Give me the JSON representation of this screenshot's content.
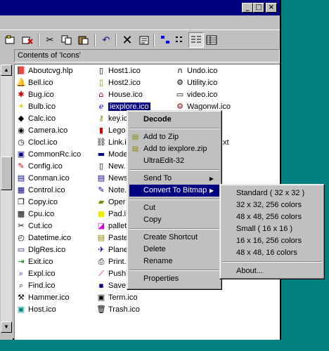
{
  "window": {
    "controls": [
      "_",
      "□",
      "×"
    ]
  },
  "toolbar": {
    "tools": [
      "new-icon",
      "delete-icon",
      "cut-icon",
      "copy-icon",
      "paste-icon",
      "undo-icon",
      "delete-x-icon",
      "properties-icon",
      "large-icons-view",
      "small-icons-view",
      "list-view",
      "details-view"
    ]
  },
  "pane": {
    "header": "Contents of 'Icons'"
  },
  "files": {
    "col1": [
      {
        "name": "Aboutcvg.hlp",
        "icon": "book-icon"
      },
      {
        "name": "Bell.ico",
        "icon": "bell-icon"
      },
      {
        "name": "Bug.ico",
        "icon": "bug-icon"
      },
      {
        "name": "Bulb.ico",
        "icon": "bulb-icon"
      },
      {
        "name": "Calc.ico",
        "icon": "calc-icon"
      },
      {
        "name": "Camera.ico",
        "icon": "camera-icon"
      },
      {
        "name": "Clocl.ico",
        "icon": "clock-icon"
      },
      {
        "name": "CommonRc.ico",
        "icon": "monitor-icon"
      },
      {
        "name": "Config.ico",
        "icon": "config-icon"
      },
      {
        "name": "Conman.ico",
        "icon": "conman-icon"
      },
      {
        "name": "Control.ico",
        "icon": "control-icon"
      },
      {
        "name": "Copy.ico",
        "icon": "copy-icon"
      },
      {
        "name": "Cpu.ico",
        "icon": "cpu-icon"
      },
      {
        "name": "Cut.ico",
        "icon": "scissors-icon"
      },
      {
        "name": "Datetime.ico",
        "icon": "datetime-icon"
      },
      {
        "name": "DlgRes.ico",
        "icon": "dialog-icon"
      },
      {
        "name": "Exit.ico",
        "icon": "exit-icon"
      },
      {
        "name": "Expl.ico",
        "icon": "explorer-icon"
      },
      {
        "name": "Find.ico",
        "icon": "find-icon"
      },
      {
        "name": "Hammer.ico",
        "icon": "hammer-icon"
      },
      {
        "name": "Host.ico",
        "icon": "host-icon"
      }
    ],
    "col2": [
      {
        "name": "Host1.ico",
        "icon": "host1-icon"
      },
      {
        "name": "Host2.ico",
        "icon": "host2-icon"
      },
      {
        "name": "House.ico",
        "icon": "house-icon"
      },
      {
        "name": "iexplore.ico",
        "icon": "ie-icon"
      },
      {
        "name": "key.ic",
        "icon": "key-icon"
      },
      {
        "name": "Lego",
        "icon": "lego-icon"
      },
      {
        "name": "Link.i",
        "icon": "link-icon"
      },
      {
        "name": "Mode",
        "icon": "modem-icon"
      },
      {
        "name": "New.",
        "icon": "new-icon"
      },
      {
        "name": "News",
        "icon": "news-icon"
      },
      {
        "name": "Note.",
        "icon": "note-icon"
      },
      {
        "name": "Oper",
        "icon": "open-icon"
      },
      {
        "name": "Pad.i",
        "icon": "pad-icon"
      },
      {
        "name": "pallet",
        "icon": "pallet-icon"
      },
      {
        "name": "Paste",
        "icon": "paste-icon"
      },
      {
        "name": "Plane",
        "icon": "plane-icon"
      },
      {
        "name": "Print.",
        "icon": "print-icon"
      },
      {
        "name": "Push",
        "icon": "push-icon"
      },
      {
        "name": "Save",
        "icon": "save-icon"
      },
      {
        "name": "Term.ico",
        "icon": "term-icon"
      },
      {
        "name": "Trash.ico",
        "icon": "trash-icon"
      }
    ],
    "col3": [
      {
        "name": "Undo.ico",
        "icon": "undo-icon"
      },
      {
        "name": "Utility.ico",
        "icon": "utility-icon"
      },
      {
        "name": "video.ico",
        "icon": "video-icon"
      },
      {
        "name": "Wagonwl.ico",
        "icon": "wagon-icon"
      }
    ],
    "col3_tail": "xt"
  },
  "context_menu": {
    "items": [
      {
        "label": "Decode",
        "bold": true
      },
      {
        "sep": true
      },
      {
        "label": "Add to Zip",
        "icon": "zip-icon"
      },
      {
        "label": "Add to iexplore.zip",
        "icon": "zip-icon"
      },
      {
        "label": "UltraEdit-32"
      },
      {
        "sep": true
      },
      {
        "label": "Send To",
        "submenu": true
      },
      {
        "label": "Convert To Bitmap",
        "submenu": true,
        "highlight": true
      },
      {
        "sep": true
      },
      {
        "label": "Cut"
      },
      {
        "label": "Copy"
      },
      {
        "sep": true
      },
      {
        "label": "Create Shortcut"
      },
      {
        "label": "Delete"
      },
      {
        "label": "Rename"
      },
      {
        "sep": true
      },
      {
        "label": "Properties"
      }
    ]
  },
  "submenu": {
    "items": [
      "Standard ( 32 x 32 )",
      "32 x 32, 256 colors",
      "48 x 48, 256 colors",
      "Small ( 16 x 16 )",
      "16 x 16, 256 colors",
      "48 x 48, 16 colors",
      "About..."
    ]
  },
  "colors": {
    "titlebar": "#000080",
    "face": "#c0c0c0",
    "desktop": "#008080",
    "highlight": "#000080"
  }
}
